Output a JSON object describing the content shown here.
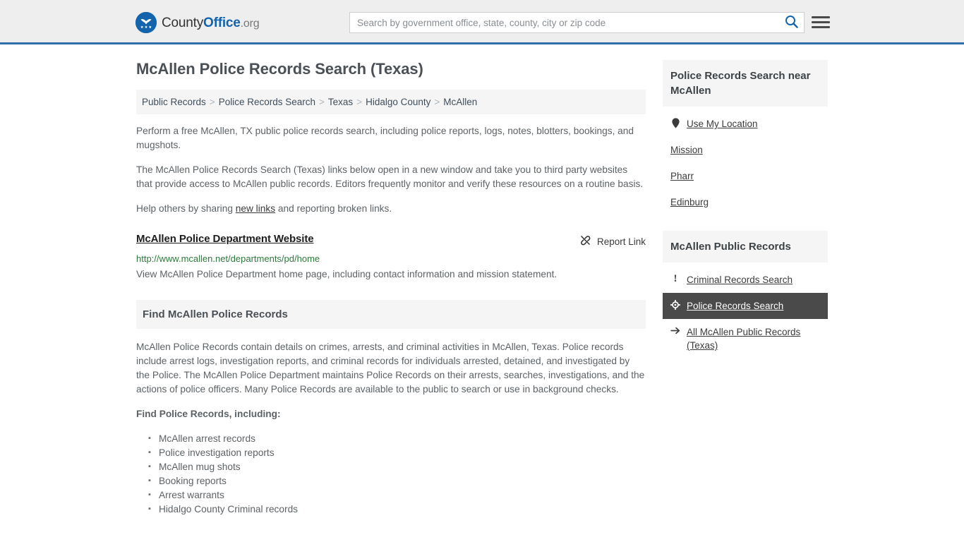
{
  "header": {
    "brand": {
      "part1": "County",
      "part2": "Office",
      "part3": ".org",
      "logo_icon": "eagle-shield-logo-icon"
    },
    "search": {
      "placeholder": "Search by government office, state, county, city or zip code",
      "value": "",
      "search_icon": "search-icon"
    },
    "menu_icon": "hamburger-menu-icon",
    "border_color": "#2f6fa7"
  },
  "page": {
    "title": "McAllen Police Records Search (Texas)"
  },
  "breadcrumb": {
    "separator": ">",
    "items": [
      {
        "label": "Public Records"
      },
      {
        "label": "Police Records Search"
      },
      {
        "label": "Texas"
      },
      {
        "label": "Hidalgo County"
      },
      {
        "label": "McAllen"
      }
    ]
  },
  "intro": {
    "p1": "Perform a free McAllen, TX public police records search, including police reports, logs, notes, blotters, bookings, and mugshots.",
    "p2": "The McAllen Police Records Search (Texas) links below open in a new window and take you to third party websites that provide access to McAllen public records. Editors frequently monitor and verify these resources on a routine basis.",
    "p3_before": "Help others by sharing ",
    "p3_link": "new links",
    "p3_after": " and reporting broken links."
  },
  "result": {
    "title": "McAllen Police Department Website",
    "url": "http://www.mcallen.net/departments/pd/home",
    "description": "View McAllen Police Department home page, including contact information and mission statement.",
    "report_label": "Report Link",
    "report_icon": "broken-link-icon",
    "url_color": "#2d7a3c"
  },
  "section": {
    "heading": "Find McAllen Police Records",
    "body": "McAllen Police Records contain details on crimes, arrests, and criminal activities in McAllen, Texas. Police records include arrest logs, investigation reports, and criminal records for individuals arrested, detained, and investigated by the Police. The McAllen Police Department maintains Police Records on their arrests, searches, investigations, and the actions of police officers. Many Police Records are available to the public to search or use in background checks.",
    "list_heading": "Find Police Records, including:",
    "list_items": [
      "McAllen arrest records",
      "Police investigation reports",
      "McAllen mug shots",
      "Booking reports",
      "Arrest warrants",
      "Hidalgo County Criminal records"
    ]
  },
  "sidebar": {
    "panel1": {
      "heading": "Police Records Search near McAllen",
      "items": [
        {
          "label": "Use My Location",
          "icon": "map-pin-icon",
          "has_icon": true,
          "active": false
        },
        {
          "label": "Mission",
          "icon": "",
          "has_icon": false,
          "active": false
        },
        {
          "label": "Pharr",
          "icon": "",
          "has_icon": false,
          "active": false
        },
        {
          "label": "Edinburg",
          "icon": "",
          "has_icon": false,
          "active": false
        }
      ]
    },
    "panel2": {
      "heading": "McAllen Public Records",
      "items": [
        {
          "label": "Criminal Records Search",
          "icon": "exclamation-icon",
          "has_icon": true,
          "active": false
        },
        {
          "label": "Police Records Search",
          "icon": "crosshair-icon",
          "has_icon": true,
          "active": true
        },
        {
          "label": "All McAllen Public Records (Texas)",
          "icon": "arrow-right-icon",
          "has_icon": true,
          "active": false
        }
      ],
      "active_bg": "#4a4a4a"
    }
  }
}
